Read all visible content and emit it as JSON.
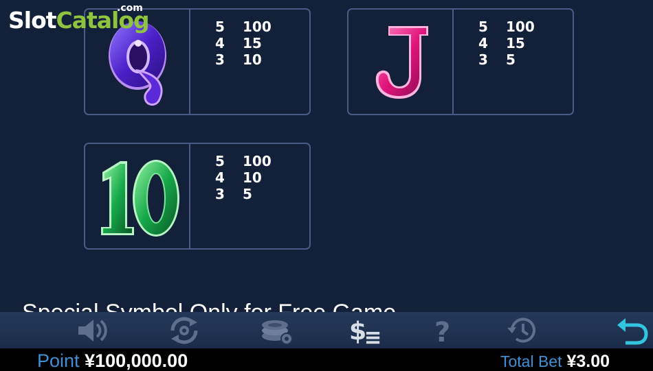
{
  "logo": {
    "part1": "Slot",
    "part2": "Catalog",
    "suffix": ".com"
  },
  "paytable": [
    {
      "symbol": "Q",
      "rows": [
        {
          "count": "5",
          "pay": "100"
        },
        {
          "count": "4",
          "pay": "15"
        },
        {
          "count": "3",
          "pay": "10"
        }
      ]
    },
    {
      "symbol": "J",
      "rows": [
        {
          "count": "5",
          "pay": "100"
        },
        {
          "count": "4",
          "pay": "15"
        },
        {
          "count": "3",
          "pay": "5"
        }
      ]
    },
    {
      "symbol": "10",
      "rows": [
        {
          "count": "5",
          "pay": "100"
        },
        {
          "count": "4",
          "pay": "10"
        },
        {
          "count": "3",
          "pay": "5"
        }
      ]
    }
  ],
  "special_text": "Special Symbol Only for Free Game",
  "toolbar_icons": [
    "sound-icon",
    "autoplay-icon",
    "chips-settings-icon",
    "paytable-icon",
    "help-icon",
    "history-icon",
    "back-icon"
  ],
  "status": {
    "point_label": "Point",
    "point_value": "¥100,000.00",
    "bet_label": "Total Bet",
    "bet_value": "¥3.00"
  },
  "colors": {
    "background": "#13203a",
    "card_border": "#4a5b86",
    "logo_green": "#8fc43e",
    "status_label": "#3d8fd6",
    "back_icon": "#33c4e0"
  }
}
